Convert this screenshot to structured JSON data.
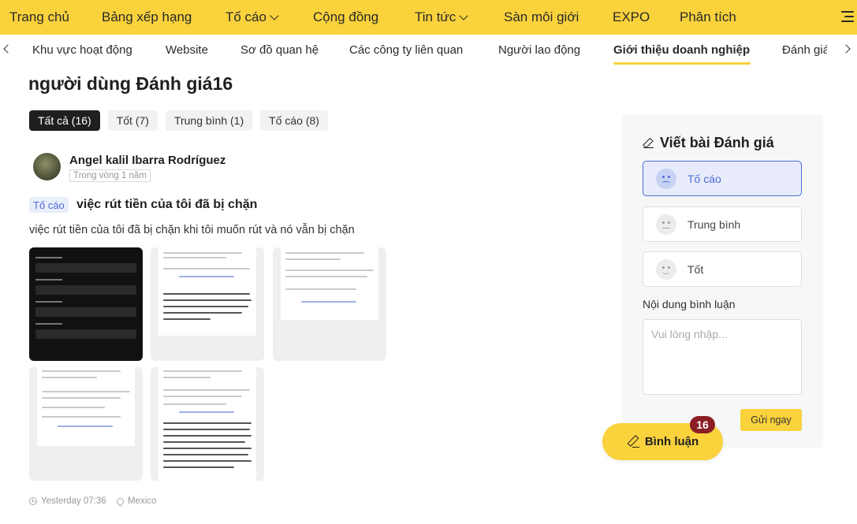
{
  "topnav": {
    "items": [
      "Trang chủ",
      "Bảng xếp hạng",
      "Tố cáo",
      "Cộng đồng",
      "Tin tức",
      "Sàn môi giới",
      "EXPO",
      "Phân tích"
    ]
  },
  "subnav": {
    "tabs": [
      "Khu vực hoạt động",
      "Website",
      "Sơ đồ quan hệ",
      "Các công ty liên quan",
      "Người lao động",
      "Giới thiệu doanh nghiệp",
      "Đánh giá"
    ]
  },
  "heading": "người dùng Đánh giá16",
  "filters": [
    "Tất cả (16)",
    "Tốt (7)",
    "Trung bình (1)",
    "Tố cáo (8)"
  ],
  "review": {
    "author": "Angel kalil Ibarra Rodríguez",
    "time_ago": "Trong vòng 1 năm",
    "badge": "Tố cáo",
    "title": "việc rút tiền của tôi đã bị chặn",
    "body": "việc rút tiền của tôi đã bị chặn khi tôi muốn rút và nó vẫn bị chặn",
    "timestamp": "Yesterday 07:36",
    "location": "Mexico"
  },
  "panel": {
    "title": "Viết bài Đánh giá",
    "options": [
      "Tố cáo",
      "Trung bình",
      "Tốt"
    ],
    "comment_label": "Nội dung bình luận",
    "placeholder": "Vui lòng nhập...",
    "send": "Gửi ngay"
  },
  "comment_button": {
    "label": "Bình luận",
    "count": "16"
  },
  "colors": {
    "brand_yellow": "#f9d23c",
    "accent_blue": "#4a6bd8",
    "badge_red": "#8b1d24"
  }
}
